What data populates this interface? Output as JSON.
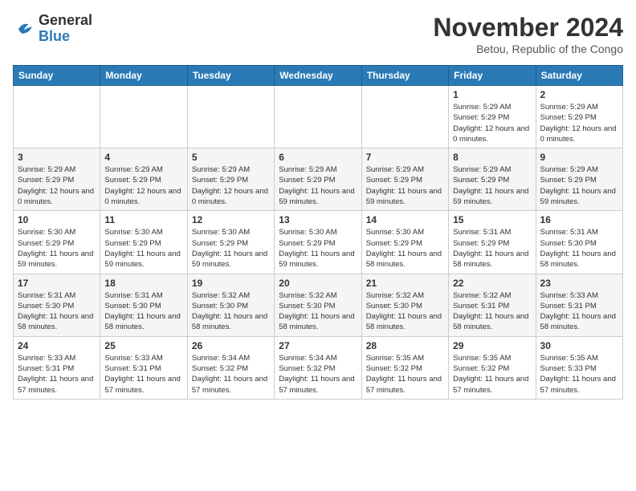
{
  "header": {
    "logo_general": "General",
    "logo_blue": "Blue",
    "month_year": "November 2024",
    "location": "Betou, Republic of the Congo"
  },
  "days_of_week": [
    "Sunday",
    "Monday",
    "Tuesday",
    "Wednesday",
    "Thursday",
    "Friday",
    "Saturday"
  ],
  "weeks": [
    {
      "row": 1,
      "cells": [
        {
          "day": "",
          "info": ""
        },
        {
          "day": "",
          "info": ""
        },
        {
          "day": "",
          "info": ""
        },
        {
          "day": "",
          "info": ""
        },
        {
          "day": "",
          "info": ""
        },
        {
          "day": "1",
          "info": "Sunrise: 5:29 AM\nSunset: 5:29 PM\nDaylight: 12 hours and 0 minutes."
        },
        {
          "day": "2",
          "info": "Sunrise: 5:29 AM\nSunset: 5:29 PM\nDaylight: 12 hours and 0 minutes."
        }
      ]
    },
    {
      "row": 2,
      "cells": [
        {
          "day": "3",
          "info": "Sunrise: 5:29 AM\nSunset: 5:29 PM\nDaylight: 12 hours and 0 minutes."
        },
        {
          "day": "4",
          "info": "Sunrise: 5:29 AM\nSunset: 5:29 PM\nDaylight: 12 hours and 0 minutes."
        },
        {
          "day": "5",
          "info": "Sunrise: 5:29 AM\nSunset: 5:29 PM\nDaylight: 12 hours and 0 minutes."
        },
        {
          "day": "6",
          "info": "Sunrise: 5:29 AM\nSunset: 5:29 PM\nDaylight: 11 hours and 59 minutes."
        },
        {
          "day": "7",
          "info": "Sunrise: 5:29 AM\nSunset: 5:29 PM\nDaylight: 11 hours and 59 minutes."
        },
        {
          "day": "8",
          "info": "Sunrise: 5:29 AM\nSunset: 5:29 PM\nDaylight: 11 hours and 59 minutes."
        },
        {
          "day": "9",
          "info": "Sunrise: 5:29 AM\nSunset: 5:29 PM\nDaylight: 11 hours and 59 minutes."
        }
      ]
    },
    {
      "row": 3,
      "cells": [
        {
          "day": "10",
          "info": "Sunrise: 5:30 AM\nSunset: 5:29 PM\nDaylight: 11 hours and 59 minutes."
        },
        {
          "day": "11",
          "info": "Sunrise: 5:30 AM\nSunset: 5:29 PM\nDaylight: 11 hours and 59 minutes."
        },
        {
          "day": "12",
          "info": "Sunrise: 5:30 AM\nSunset: 5:29 PM\nDaylight: 11 hours and 59 minutes."
        },
        {
          "day": "13",
          "info": "Sunrise: 5:30 AM\nSunset: 5:29 PM\nDaylight: 11 hours and 59 minutes."
        },
        {
          "day": "14",
          "info": "Sunrise: 5:30 AM\nSunset: 5:29 PM\nDaylight: 11 hours and 58 minutes."
        },
        {
          "day": "15",
          "info": "Sunrise: 5:31 AM\nSunset: 5:29 PM\nDaylight: 11 hours and 58 minutes."
        },
        {
          "day": "16",
          "info": "Sunrise: 5:31 AM\nSunset: 5:30 PM\nDaylight: 11 hours and 58 minutes."
        }
      ]
    },
    {
      "row": 4,
      "cells": [
        {
          "day": "17",
          "info": "Sunrise: 5:31 AM\nSunset: 5:30 PM\nDaylight: 11 hours and 58 minutes."
        },
        {
          "day": "18",
          "info": "Sunrise: 5:31 AM\nSunset: 5:30 PM\nDaylight: 11 hours and 58 minutes."
        },
        {
          "day": "19",
          "info": "Sunrise: 5:32 AM\nSunset: 5:30 PM\nDaylight: 11 hours and 58 minutes."
        },
        {
          "day": "20",
          "info": "Sunrise: 5:32 AM\nSunset: 5:30 PM\nDaylight: 11 hours and 58 minutes."
        },
        {
          "day": "21",
          "info": "Sunrise: 5:32 AM\nSunset: 5:30 PM\nDaylight: 11 hours and 58 minutes."
        },
        {
          "day": "22",
          "info": "Sunrise: 5:32 AM\nSunset: 5:31 PM\nDaylight: 11 hours and 58 minutes."
        },
        {
          "day": "23",
          "info": "Sunrise: 5:33 AM\nSunset: 5:31 PM\nDaylight: 11 hours and 58 minutes."
        }
      ]
    },
    {
      "row": 5,
      "cells": [
        {
          "day": "24",
          "info": "Sunrise: 5:33 AM\nSunset: 5:31 PM\nDaylight: 11 hours and 57 minutes."
        },
        {
          "day": "25",
          "info": "Sunrise: 5:33 AM\nSunset: 5:31 PM\nDaylight: 11 hours and 57 minutes."
        },
        {
          "day": "26",
          "info": "Sunrise: 5:34 AM\nSunset: 5:32 PM\nDaylight: 11 hours and 57 minutes."
        },
        {
          "day": "27",
          "info": "Sunrise: 5:34 AM\nSunset: 5:32 PM\nDaylight: 11 hours and 57 minutes."
        },
        {
          "day": "28",
          "info": "Sunrise: 5:35 AM\nSunset: 5:32 PM\nDaylight: 11 hours and 57 minutes."
        },
        {
          "day": "29",
          "info": "Sunrise: 5:35 AM\nSunset: 5:32 PM\nDaylight: 11 hours and 57 minutes."
        },
        {
          "day": "30",
          "info": "Sunrise: 5:35 AM\nSunset: 5:33 PM\nDaylight: 11 hours and 57 minutes."
        }
      ]
    }
  ]
}
